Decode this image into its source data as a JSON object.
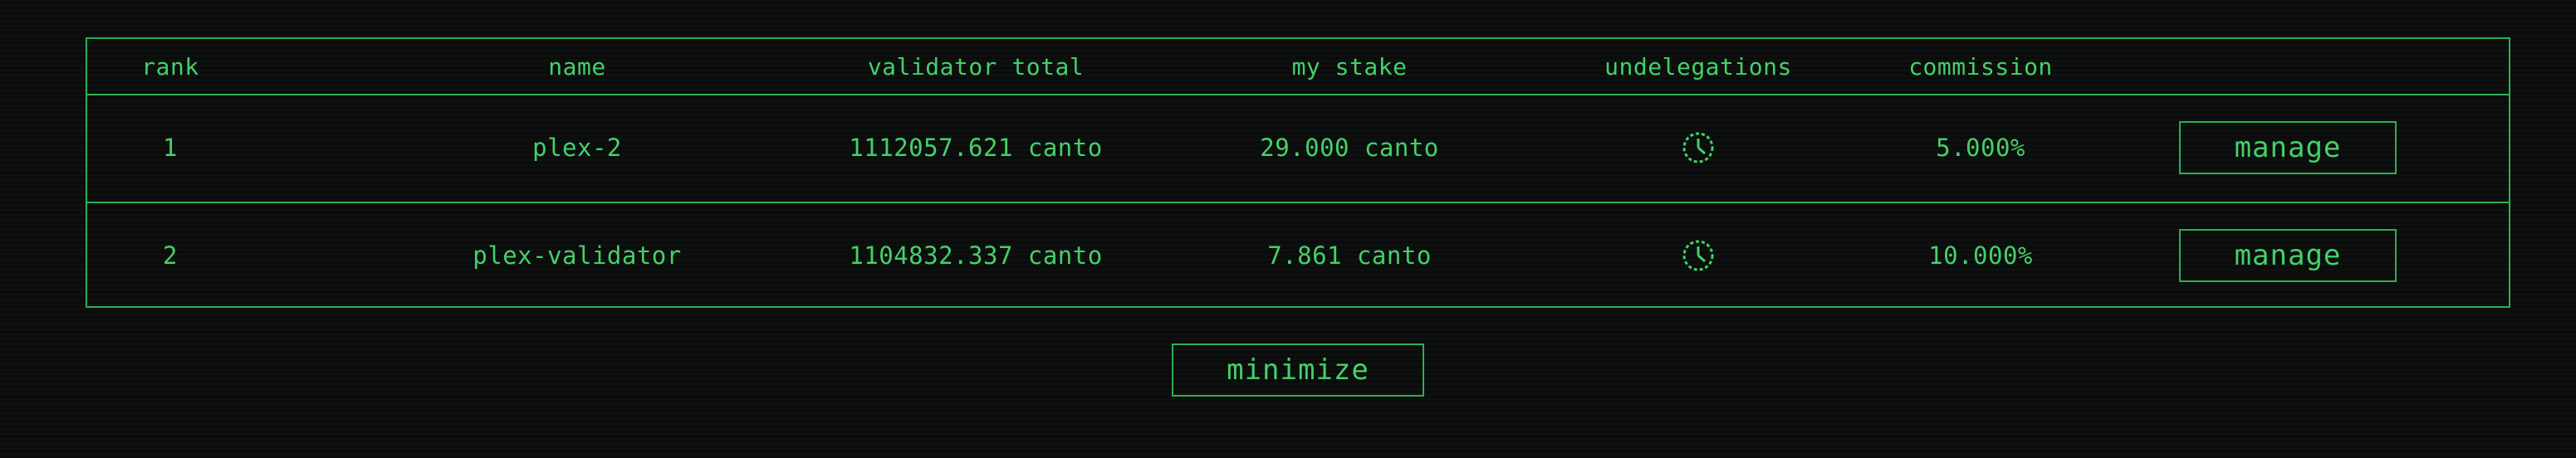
{
  "table": {
    "headers": {
      "rank": "rank",
      "name": "name",
      "validator_total": "validator total",
      "my_stake": "my stake",
      "undelegations": "undelegations",
      "commission": "commission"
    },
    "rows": [
      {
        "rank": "1",
        "name": "plex-2",
        "validator_total": "1112057.621 canto",
        "my_stake": "29.000 canto",
        "undelegations_icon": "clock-icon",
        "commission": "5.000%",
        "action_label": "manage"
      },
      {
        "rank": "2",
        "name": "plex-validator",
        "validator_total": "1104832.337 canto",
        "my_stake": "7.861 canto",
        "undelegations_icon": "clock-icon",
        "commission": "10.000%",
        "action_label": "manage"
      }
    ]
  },
  "footer": {
    "minimize_label": "minimize"
  },
  "colors": {
    "background": "#0a0d0b",
    "accent": "#45d06a",
    "border": "#2fae55"
  }
}
